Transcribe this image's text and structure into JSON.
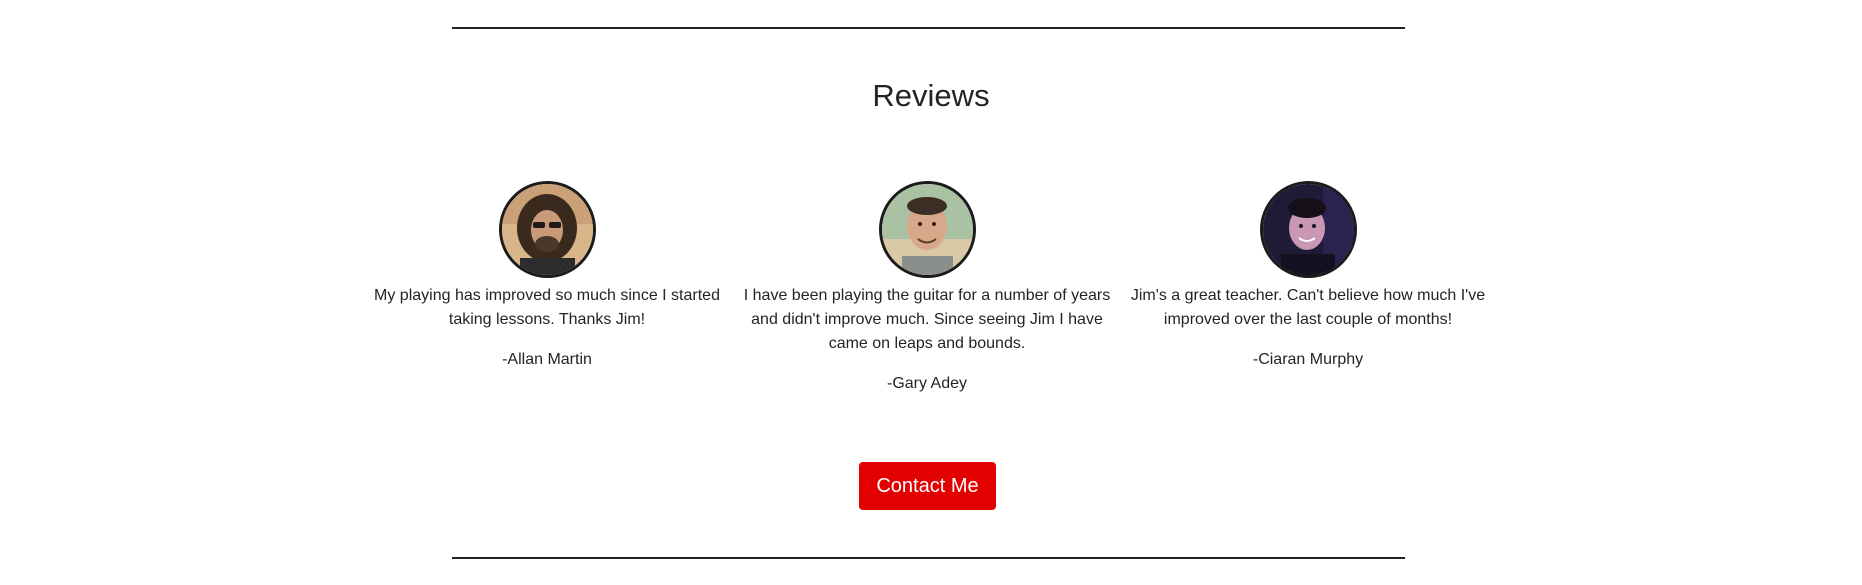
{
  "section": {
    "title": "Reviews"
  },
  "reviews": [
    {
      "quote": "My playing has improved so much since I started taking lessons. Thanks Jim!",
      "author": "-Allan Martin",
      "avatar_icon": "reviewer-photo-allan-icon"
    },
    {
      "quote": "I have been playing the guitar for a number of years and didn't improve much. Since seeing Jim I have came on leaps and bounds.",
      "author": "-Gary Adey",
      "avatar_icon": "reviewer-photo-gary-icon"
    },
    {
      "quote": "Jim's a great teacher. Can't believe how much I've improved over the last couple of months!",
      "author": "-Ciaran Murphy",
      "avatar_icon": "reviewer-photo-ciaran-icon"
    }
  ],
  "cta": {
    "label": "Contact Me"
  },
  "colors": {
    "button_bg": "#e20000",
    "button_text": "#ffffff",
    "divider": "#222222",
    "text": "#212529"
  }
}
